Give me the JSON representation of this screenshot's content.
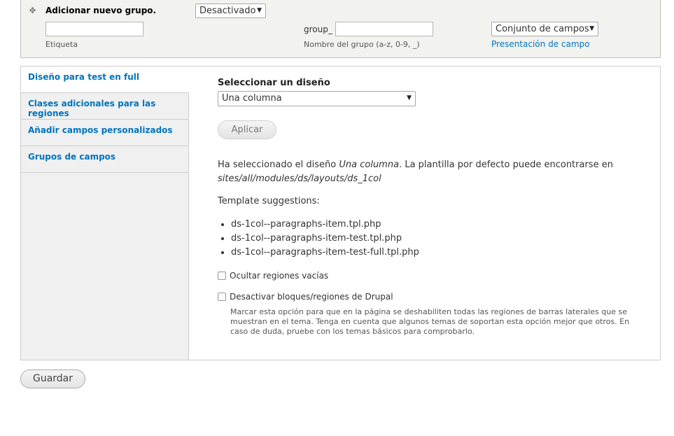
{
  "new_group": {
    "title": "Adicionar nuevo grupo.",
    "status_select": "Desactivado",
    "label_input_value": "",
    "label_caption": "Etiqueta",
    "machine_prefix": "group_",
    "machine_input_value": "",
    "machine_caption": "Nombre del grupo (a-z, 0-9, _)",
    "format_select": "Conjunto de campos",
    "format_link": "Presentación de campo"
  },
  "tabs": [
    {
      "label": "Diseño para test en full"
    },
    {
      "label": "Clases adicionales para las regiones"
    },
    {
      "label": "Añadir campos personalizados"
    },
    {
      "label": "Grupos de campos"
    }
  ],
  "layout": {
    "heading": "Seleccionar un diseño",
    "select_value": "Una columna",
    "apply_label": "Aplicar",
    "desc_prefix": "Ha seleccionado el diseño ",
    "desc_layout": "Una columna",
    "desc_middle": ". La plantilla por defecto puede encontrarse en",
    "desc_path": "sites/all/modules/ds/layouts/ds_1col",
    "suggestions_title": "Template suggestions:",
    "suggestions": [
      "ds-1col--paragraphs-item.tpl.php",
      "ds-1col--paragraphs-item-test.tpl.php",
      "ds-1col--paragraphs-item-test-full.tpl.php"
    ],
    "hide_empty_label": "Ocultar regiones vacías",
    "disable_blocks_label": "Desactivar bloques/regiones de Drupal",
    "disable_blocks_help": "Marcar esta opción para que en la página se deshabiliten todas las regiones de barras laterales que se muestran en el tema. Tenga en cuenta que algunos temas de soportan esta opción mejor que otros. En caso de duda, pruebe con los temas básicos para comprobarlo."
  },
  "save_label": "Guardar",
  "colors": {
    "link": "#0074bd",
    "band": "#f2f2ee",
    "tabs_bg": "#f0f0f0"
  }
}
